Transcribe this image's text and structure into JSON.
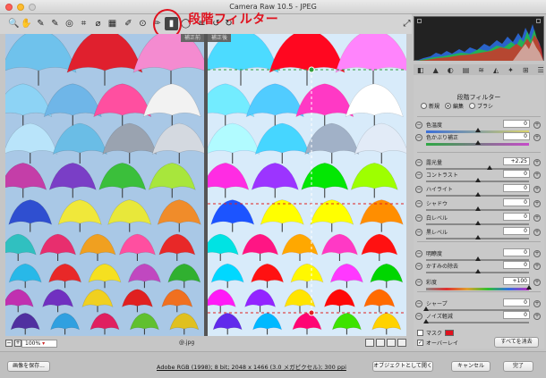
{
  "window": {
    "title": "Camera Raw 10.5  -  JPEG"
  },
  "toolbar": {
    "tools": [
      {
        "name": "zoom-tool-icon",
        "glyph": "🔍"
      },
      {
        "name": "hand-tool-icon",
        "glyph": "✋"
      },
      {
        "name": "white-balance-tool-icon",
        "glyph": "✎"
      },
      {
        "name": "color-sampler-tool-icon",
        "glyph": "✎"
      },
      {
        "name": "targeted-adjustment-tool-icon",
        "glyph": "◎"
      },
      {
        "name": "crop-tool-icon",
        "glyph": "⌗"
      },
      {
        "name": "straighten-tool-icon",
        "glyph": "⌀"
      },
      {
        "name": "transform-tool-icon",
        "glyph": "▦"
      },
      {
        "name": "spot-removal-tool-icon",
        "glyph": "✐"
      },
      {
        "name": "red-eye-tool-icon",
        "glyph": "⊙"
      },
      {
        "name": "adjustment-brush-icon",
        "glyph": "✏"
      },
      {
        "name": "graduated-filter-icon",
        "glyph": "▮"
      },
      {
        "name": "radial-filter-icon",
        "glyph": "◯"
      },
      {
        "name": "preferences-icon",
        "glyph": "≡"
      },
      {
        "name": "rotate-ccw-icon",
        "glyph": "↺"
      },
      {
        "name": "rotate-cw-icon",
        "glyph": "↻"
      }
    ],
    "fullscreen_icon": "⤢"
  },
  "annotation": {
    "label": "段階フィルター",
    "color": "#e0121e"
  },
  "preview": {
    "before_label": "補正前",
    "after_label": "補正後",
    "zoom": "100%",
    "filename": "@.jpg"
  },
  "histogram": {
    "r_label": "R:",
    "g_label": "G:",
    "b_label": "B:",
    "r_value": "---",
    "g_value": "---",
    "b_value": "---"
  },
  "panel": {
    "title": "段階フィルター",
    "modes": [
      {
        "label": "新規",
        "selected": false
      },
      {
        "label": "編集",
        "selected": true
      },
      {
        "label": "ブラシ",
        "selected": false
      }
    ],
    "sliders": [
      {
        "label": "色温度",
        "value": "0"
      },
      {
        "label": "色かぶり補正",
        "value": "0"
      },
      {
        "label": "露光量",
        "value": "+2.25"
      },
      {
        "label": "コントラスト",
        "value": "0"
      },
      {
        "label": "ハイライト",
        "value": "0"
      },
      {
        "label": "シャドウ",
        "value": "0"
      },
      {
        "label": "白レベル",
        "value": "0"
      },
      {
        "label": "黒レベル",
        "value": "0"
      },
      {
        "label": "明瞭度",
        "value": "0"
      },
      {
        "label": "かすみの除去",
        "value": "0"
      },
      {
        "label": "彩度",
        "value": "+100"
      },
      {
        "label": "シャープ",
        "value": "0"
      },
      {
        "label": "ノイズ軽減",
        "value": "0"
      }
    ],
    "mask_label": "マスク",
    "overlay_label": "オーバーレイ",
    "clear_all_label": "すべてを消去",
    "mask_color": "#e0121e"
  },
  "bottom": {
    "save_label": "画像を保存...",
    "workflow_link": "Adobe RGB (1998); 8 bit; 2048 x 1466 (3.0 メガピクセル); 300 ppi",
    "open_object_label": "オブジェクトとして開く",
    "cancel_label": "キャンセル",
    "done_label": "完了"
  }
}
